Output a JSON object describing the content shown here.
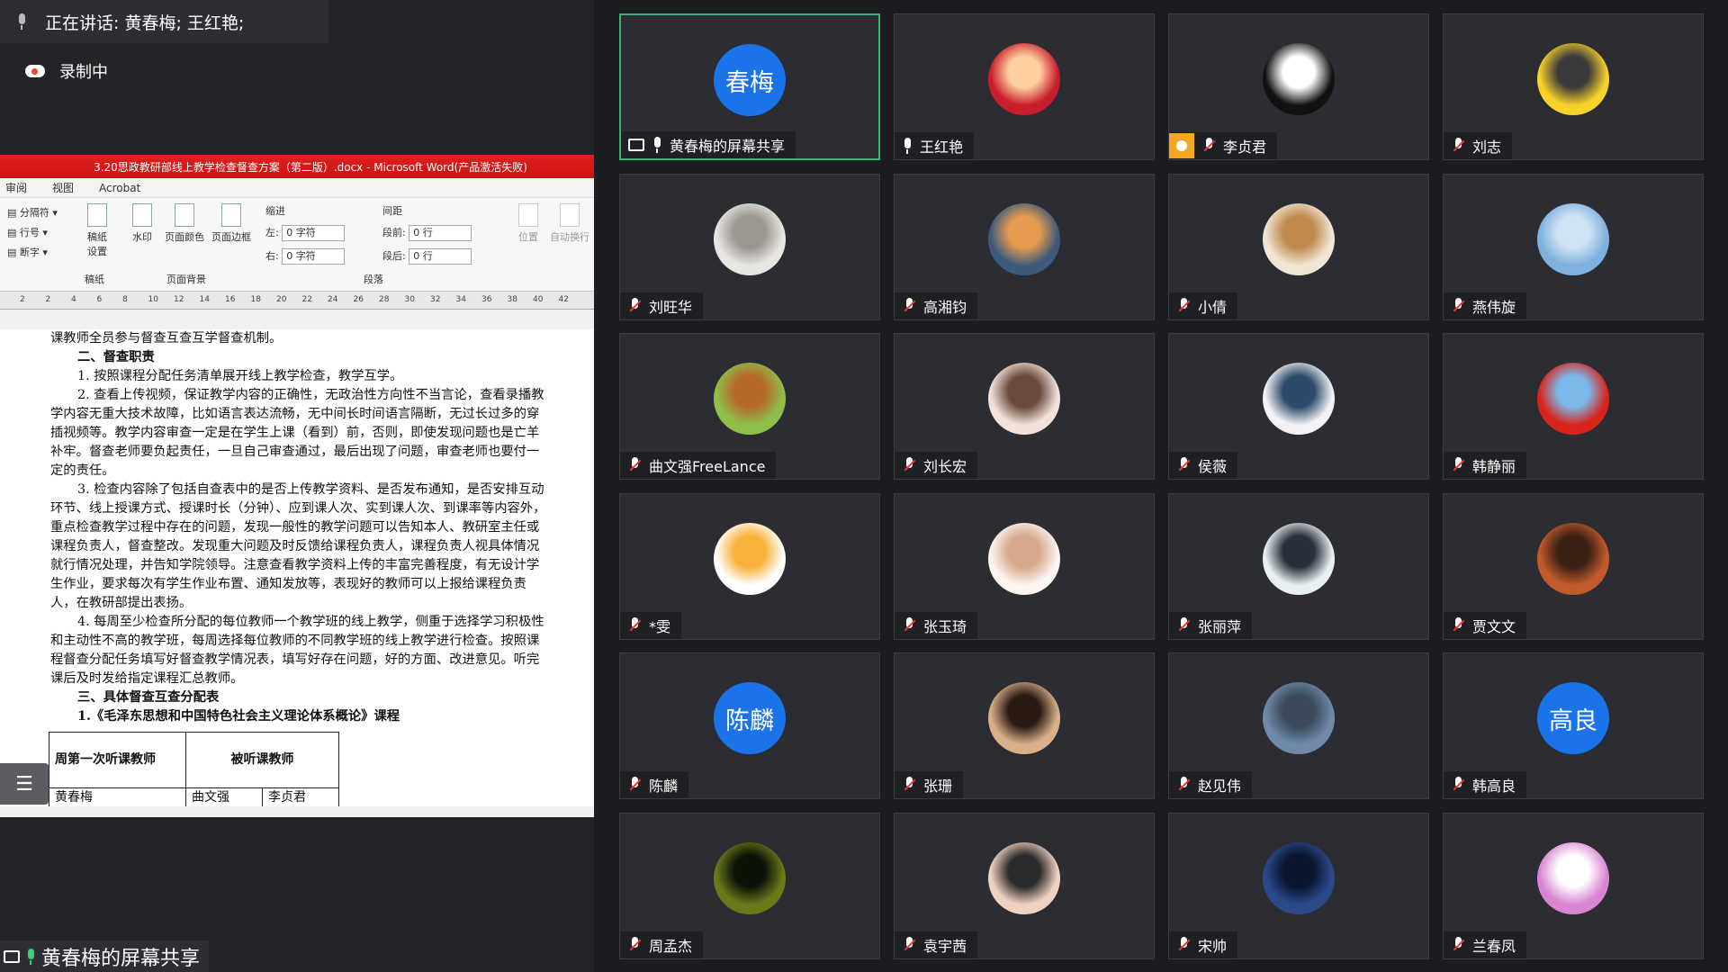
{
  "top": {
    "speaking_text": "正在讲话: 黄春梅; 王红艳;",
    "recording_text": "录制中"
  },
  "word": {
    "title": "3.20思政教研部线上教学检查督查方案（第二版）.docx - Microsoft Word(产品激活失败)",
    "tabs": [
      "审阅",
      "视图",
      "Acrobat"
    ],
    "ribbon": {
      "breaks": "分隔符",
      "line_numbers": "行号",
      "hyphenation": "断字",
      "draft": "稿纸设置",
      "watermark": "水印",
      "page_color": "页面颜色",
      "page_border": "页面边框",
      "page_bg_group": "页面背景",
      "draft_group": "稿纸",
      "indent_label": "缩进",
      "spacing_label": "间距",
      "left_label": "左:",
      "right_label": "右:",
      "before_label": "段前:",
      "after_label": "段后:",
      "left_value": "0 字符",
      "right_value": "0 字符",
      "before_value": "0 行",
      "after_value": "0 行",
      "paragraph_group": "段落",
      "position": "位置",
      "autowrap": "自动换行"
    },
    "ruler_ticks": [
      "2",
      "2",
      "4",
      "6",
      "8",
      "10",
      "12",
      "14",
      "16",
      "18",
      "20",
      "22",
      "24",
      "26",
      "28",
      "30",
      "32",
      "34",
      "36",
      "38",
      "40",
      "42"
    ],
    "doc": {
      "line0": "课教师全员参与督查互查互学督查机制。",
      "h2": "二、督查职责",
      "p1": "1. 按照课程分配任务清单展开线上教学检查，教学互学。",
      "p2": "2. 查看上传视频，保证教学内容的正确性，无政治性方向性不当言论，查看录播教学内容无重大技术故障，比如语言表达流畅，无中间长时间语言隔断，无过长过多的穿插视频等。教学内容审查一定是在学生上课（看到）前，否则，即使发现问题也是亡羊补牢。督查老师要负起责任，一旦自己审查通过，最后出现了问题，审查老师也要付一定的责任。",
      "p3": "3. 检查内容除了包括自查表中的是否上传教学资料、是否发布通知，是否安排互动环节、线上授课方式、授课时长（分钟）、应到课人次、实到课人次、到课率等内容外，重点检查教学过程中存在的问题，发现一般性的教学问题可以告知本人、教研室主任或课程负责人，督查整改。发现重大问题及时反馈给课程负责人，课程负责人视具体情况就行情况处理，并告知学院领导。注意查看教学资料上传的丰富完善程度，有无设计学生作业，要求每次有学生作业布置、通知发放等，表现好的教师可以上报给课程负责人，在教研部提出表扬。",
      "p4": "4. 每周至少检查所分配的每位教师一个教学班的线上教学，侧重于选择学习积极性和主动性不高的教学班，每周选择每位教师的不同教学班的线上教学进行检查。按照课程督查分配任务填写好督查教学情况表，填写好存在问题，好的方面、改进意见。听完课后及时发给指定课程汇总教师。",
      "h3": "三、具体督查互查分配表",
      "h3sub": "1.《毛泽东思想和中国特色社会主义理论体系概论》课程",
      "th1": "周第一次听课教师",
      "th2": "被听课教师",
      "td1": "黄春梅",
      "td2": "曲文强",
      "td3": "李贞君"
    }
  },
  "share_label": "黄春梅的屏幕共享",
  "tiles": [
    {
      "name": "黄春梅的屏幕共享",
      "avatar_text": "春梅",
      "type": "text",
      "active": true,
      "mic": "on",
      "share": true
    },
    {
      "name": "王红艳",
      "type": "img",
      "colors": [
        "#c81d2a",
        "#ffcfa0"
      ],
      "mic": "on"
    },
    {
      "name": "李贞君",
      "type": "img",
      "colors": [
        "#111111",
        "#ffffff"
      ],
      "mic": "muted",
      "badge": true
    },
    {
      "name": "刘志",
      "type": "img",
      "colors": [
        "#f7d22a",
        "#3a3a3a"
      ],
      "mic": "muted"
    },
    {
      "name": "刘旺华",
      "type": "img",
      "colors": [
        "#e8e6e2",
        "#9a9690"
      ],
      "mic": "muted"
    },
    {
      "name": "高湘钧",
      "type": "img",
      "colors": [
        "#3d5a7a",
        "#e59a4f"
      ],
      "mic": "muted"
    },
    {
      "name": "小倩",
      "type": "img",
      "colors": [
        "#f1e6d6",
        "#c08a4d"
      ],
      "mic": "muted"
    },
    {
      "name": "燕伟旋",
      "type": "img",
      "colors": [
        "#7fb0de",
        "#cfe3f5"
      ],
      "mic": "muted"
    },
    {
      "name": "曲文强FreeLance",
      "type": "img",
      "colors": [
        "#8fbf4b",
        "#b56a2a"
      ],
      "mic": "muted"
    },
    {
      "name": "刘长宏",
      "type": "img",
      "colors": [
        "#f3e2dc",
        "#6a4a3a"
      ],
      "mic": "muted"
    },
    {
      "name": "侯薇",
      "type": "img",
      "colors": [
        "#f1f3f6",
        "#2d4a6a"
      ],
      "mic": "muted"
    },
    {
      "name": "韩静丽",
      "type": "img",
      "colors": [
        "#d9241c",
        "#79b8e8"
      ],
      "mic": "muted"
    },
    {
      "name": "*雯",
      "type": "img",
      "colors": [
        "#ffffff",
        "#f7b23a"
      ],
      "mic": "muted"
    },
    {
      "name": "张玉琦",
      "type": "img",
      "colors": [
        "#fbf4ef",
        "#d7a98c"
      ],
      "mic": "muted"
    },
    {
      "name": "张丽萍",
      "type": "img",
      "colors": [
        "#e8f0f2",
        "#28303a"
      ],
      "mic": "muted"
    },
    {
      "name": "贾文文",
      "type": "img",
      "colors": [
        "#c25a2a",
        "#3a2014"
      ],
      "mic": "muted"
    },
    {
      "name": "陈麟",
      "avatar_text": "陈麟",
      "type": "text",
      "mic": "muted"
    },
    {
      "name": "张珊",
      "type": "img",
      "colors": [
        "#d9b08a",
        "#2a1a14"
      ],
      "mic": "muted"
    },
    {
      "name": "赵见伟",
      "type": "img",
      "colors": [
        "#6f8aa8",
        "#3a4a5a"
      ],
      "mic": "muted"
    },
    {
      "name": "韩高良",
      "avatar_text": "高良",
      "type": "text",
      "mic": "muted"
    },
    {
      "name": "周孟杰",
      "type": "img",
      "colors": [
        "#6a7a1a",
        "#0c1208"
      ],
      "mic": "muted"
    },
    {
      "name": "袁宇茜",
      "type": "img",
      "colors": [
        "#f1d2c0",
        "#2a2a2a"
      ],
      "mic": "muted"
    },
    {
      "name": "宋帅",
      "type": "img",
      "colors": [
        "#2c4a8a",
        "#0a1530"
      ],
      "mic": "muted"
    },
    {
      "name": "兰春凤",
      "type": "img",
      "colors": [
        "#d884d2",
        "#ffffff"
      ],
      "mic": "muted"
    }
  ]
}
